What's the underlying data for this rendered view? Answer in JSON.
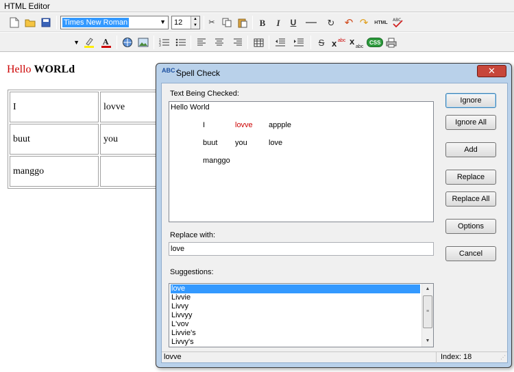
{
  "app": {
    "title": "HTML Editor"
  },
  "toolbar": {
    "font_family": "Times New Roman",
    "font_size": "12",
    "style_value": ""
  },
  "document": {
    "hello_red": "Hello ",
    "hello_black": "WORLd",
    "table": [
      [
        "I",
        "lovve"
      ],
      [
        "buut",
        "you"
      ],
      [
        "manggo",
        ""
      ]
    ]
  },
  "dialog": {
    "title": "Spell Check",
    "text_label": "Text Being Checked:",
    "text_line1": "Hello World",
    "text_words": {
      "r1c1": "I",
      "r1c2": "lovve",
      "r1c3": "appple",
      "r2c1": "buut",
      "r2c2": "you",
      "r2c3": "love",
      "r3c1": "manggo"
    },
    "replace_label": "Replace with:",
    "replace_value": "love",
    "suggestions_label": "Suggestions:",
    "suggestions": [
      "love",
      "Livvie",
      "Livvy",
      "Livvyy",
      "L'vov",
      "Livvie's",
      "Livvy's"
    ],
    "buttons": {
      "ignore": "Ignore",
      "ignore_all": "Ignore All",
      "add": "Add",
      "replace": "Replace",
      "replace_all": "Replace All",
      "options": "Options",
      "cancel": "Cancel"
    },
    "status_word": "lovve",
    "status_index": "Index: 18"
  },
  "colors": {
    "selection": "#3399ff",
    "misspelled": "#cc0000",
    "close_button": "#c7463a",
    "dialog_frame": "#b9d1ea"
  }
}
